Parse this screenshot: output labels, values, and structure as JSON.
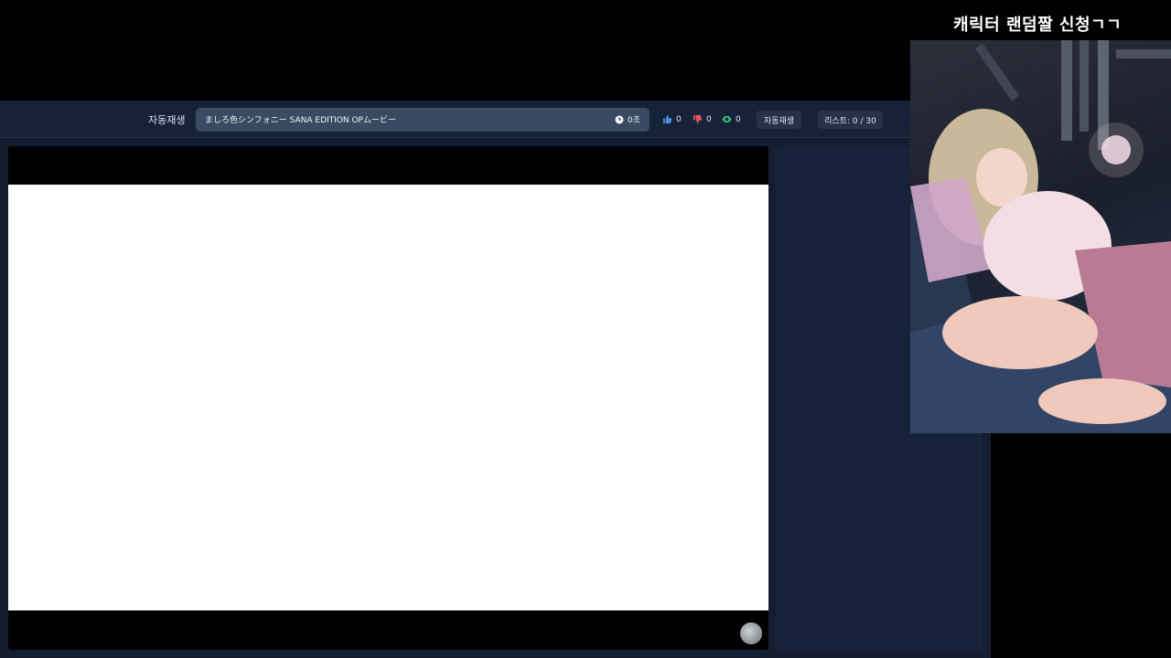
{
  "overlay": {
    "title": "캐릭터 랜덤짤 신청ㄱㄱ"
  },
  "topbar": {
    "autoplay_label": "자동재생",
    "song_title": "ましろ色シンフォニー SANA EDITION OPムービー",
    "timer": "0초",
    "likes": "0",
    "dislikes": "0",
    "views": "0",
    "autoplay_button": "자동재생",
    "list_count": "리스트: 0 / 30"
  },
  "colors": {
    "like_icon": "#4a90e2",
    "dislike_icon": "#e25563",
    "view_icon": "#36c06a",
    "background": "#000000",
    "panel": "#141e30"
  }
}
